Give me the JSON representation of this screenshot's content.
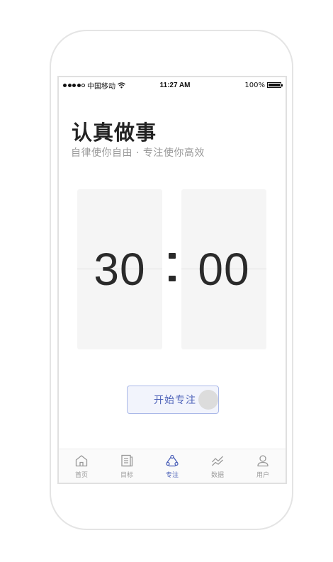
{
  "status_bar": {
    "carrier": "中国移动",
    "time": "11:27 AM",
    "battery": "100%",
    "battery_level": 1.0
  },
  "header": {
    "title": "认真做事",
    "subtitle": "自律使你自由 · 专注使你高效"
  },
  "timer": {
    "minutes": "30",
    "seconds": "00"
  },
  "start_button": {
    "label": "开始专注"
  },
  "tab_bar": {
    "items": [
      {
        "label": "首页",
        "icon": "home-icon",
        "active": false
      },
      {
        "label": "目标",
        "icon": "document-icon",
        "active": false
      },
      {
        "label": "专注",
        "icon": "focus-icon",
        "active": true
      },
      {
        "label": "数据",
        "icon": "chart-icon",
        "active": false
      },
      {
        "label": "用户",
        "icon": "user-icon",
        "active": false
      }
    ]
  },
  "colors": {
    "accent": "#4a5fb7",
    "inactive": "#999999",
    "card_bg": "#f5f5f5"
  }
}
